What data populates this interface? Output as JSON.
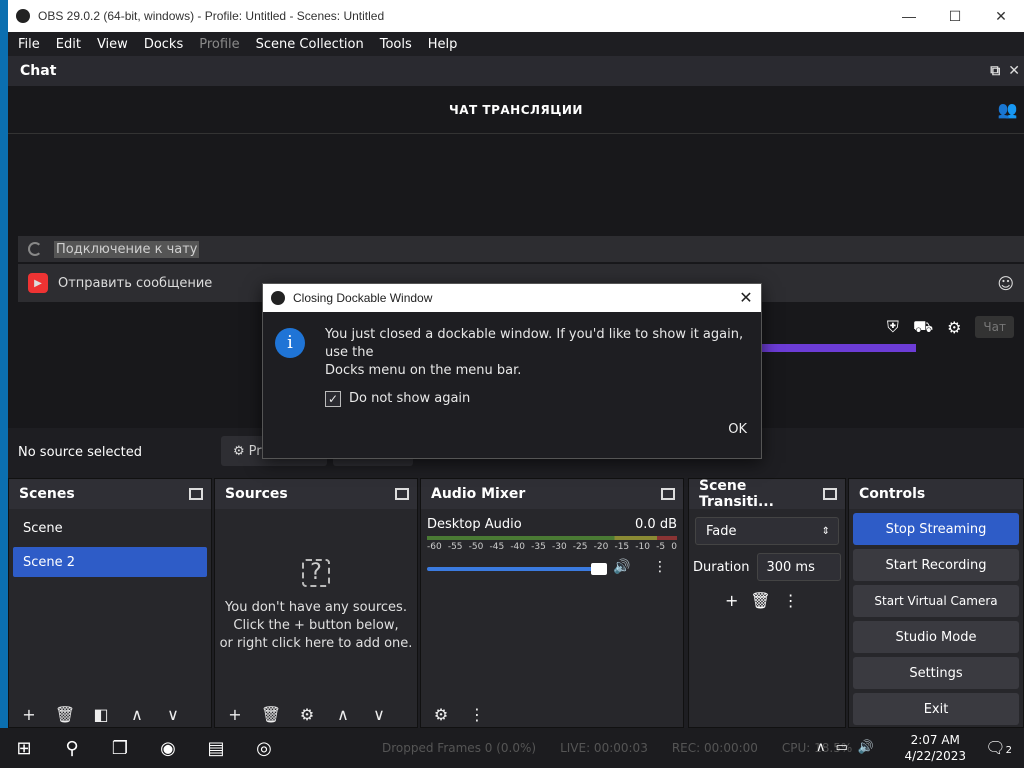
{
  "window": {
    "title": "OBS 29.0.2 (64-bit, windows) - Profile: Untitled - Scenes: Untitled",
    "minimize": "—",
    "maximize": "☐",
    "close": "✕"
  },
  "menu": [
    {
      "label": "File",
      "disabled": false
    },
    {
      "label": "Edit",
      "disabled": false
    },
    {
      "label": "View",
      "disabled": false
    },
    {
      "label": "Docks",
      "disabled": false
    },
    {
      "label": "Profile",
      "disabled": true
    },
    {
      "label": "Scene Collection",
      "disabled": false
    },
    {
      "label": "Tools",
      "disabled": false
    },
    {
      "label": "Help",
      "disabled": false
    }
  ],
  "chat": {
    "dock_title": "Chat",
    "header": "ЧАТ ТРАНСЛЯЦИИ",
    "connecting": "Подключение к чату",
    "send_placeholder": "Отправить сообщение",
    "chat_button": "Чат"
  },
  "source_bar": {
    "status": "No source selected",
    "properties": "Pr"
  },
  "scenes": {
    "title": "Scenes",
    "items": [
      {
        "label": "Scene",
        "selected": false
      },
      {
        "label": "Scene 2",
        "selected": true
      }
    ]
  },
  "sources": {
    "title": "Sources",
    "empty_line1": "You don't have any sources.",
    "empty_line2": "Click the + button below,",
    "empty_line3": "or right click here to add one."
  },
  "mixer": {
    "title": "Audio Mixer",
    "channel": "Desktop Audio",
    "level": "0.0 dB",
    "ticks": [
      "-60",
      "-55",
      "-50",
      "-45",
      "-40",
      "-35",
      "-30",
      "-25",
      "-20",
      "-15",
      "-10",
      "-5",
      "0"
    ],
    "volume_fraction": 1.0
  },
  "transitions": {
    "title": "Scene Transiti...",
    "selected": "Fade",
    "duration_label": "Duration",
    "duration_value": "300 ms"
  },
  "controls": {
    "title": "Controls",
    "stop_streaming": "Stop Streaming",
    "start_recording": "Start Recording",
    "start_virtual_camera": "Start Virtual Camera",
    "studio_mode": "Studio Mode",
    "settings": "Settings",
    "exit": "Exit"
  },
  "dialog": {
    "title": "Closing Dockable Window",
    "message_line1": "You just closed a dockable window. If you'd like to show it again, use the",
    "message_line2": "Docks menu on the menu bar.",
    "checkbox_label": "Do not show again",
    "checkbox_checked": true,
    "ok": "OK"
  },
  "taskbar": {
    "status_dropped": "Dropped Frames 0 (0.0%)",
    "status_live": "LIVE: 00:00:03",
    "status_rec": "REC: 00:00:00",
    "status_cpu": "CPU: 18.5%",
    "time": "2:07 AM",
    "date": "4/22/2023",
    "notifications": "2"
  },
  "colors": {
    "accent": "#2e5cc7",
    "youtube": "#e33333",
    "twitch_purple": "#6c3cd6"
  }
}
